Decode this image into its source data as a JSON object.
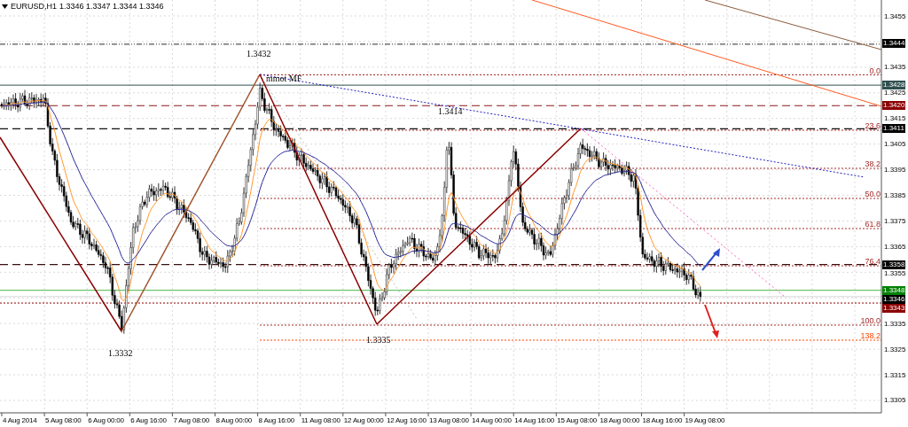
{
  "header": {
    "symbol": "EURUSD,H1",
    "quotes": [
      "1.3346",
      "1.3347",
      "1.3344",
      "1.3346"
    ]
  },
  "price_axis": {
    "ticks": [
      "1.3455",
      "1.3435",
      "1.3425",
      "1.3415",
      "1.3405",
      "1.3395",
      "1.3385",
      "1.3375",
      "1.3365",
      "1.3355",
      "1.3335",
      "1.3325",
      "1.3315",
      "1.3305"
    ],
    "tags": [
      {
        "text": "1.3444",
        "color": "#000000"
      },
      {
        "text": "1.3428",
        "color": "#2f4f4f"
      },
      {
        "text": "1.3420",
        "color": "#8b0000"
      },
      {
        "text": "1.3411",
        "color": "#000000"
      },
      {
        "text": "1.3358",
        "color": "#000000"
      },
      {
        "text": "1.3348",
        "color": "#008000"
      },
      {
        "text": "1.3346",
        "color": "#000000"
      },
      {
        "text": "1.3343",
        "color": "#8b0000"
      }
    ]
  },
  "time_axis": {
    "labels": [
      "4 Aug 2014",
      "5 Aug 08:00",
      "6 Aug 00:00",
      "6 Aug 16:00",
      "7 Aug 08:00",
      "8 Aug 00:00",
      "8 Aug 16:00",
      "11 Aug 08:00",
      "12 Aug 00:00",
      "12 Aug 16:00",
      "13 Aug 08:00",
      "14 Aug 00:00",
      "14 Aug 16:00",
      "15 Aug 08:00",
      "18 Aug 00:00",
      "18 Aug 16:00",
      "19 Aug 08:00"
    ]
  },
  "fibonacci_levels": [
    {
      "label": "0.0",
      "kind": "retracement"
    },
    {
      "label": "23.6",
      "kind": "retracement"
    },
    {
      "label": "38.2",
      "kind": "retracement"
    },
    {
      "label": "50.0",
      "kind": "retracement"
    },
    {
      "label": "61.8",
      "kind": "retracement"
    },
    {
      "label": "76.4",
      "kind": "retracement"
    },
    {
      "label": "100.0",
      "kind": "retracement"
    },
    {
      "label": "138.2",
      "kind": "extension"
    }
  ],
  "annotations": [
    {
      "text": "1.3432"
    },
    {
      "text": "mmot MF"
    },
    {
      "text": "1.3414"
    },
    {
      "text": "1.3332"
    },
    {
      "text": "1.3335"
    }
  ]
}
